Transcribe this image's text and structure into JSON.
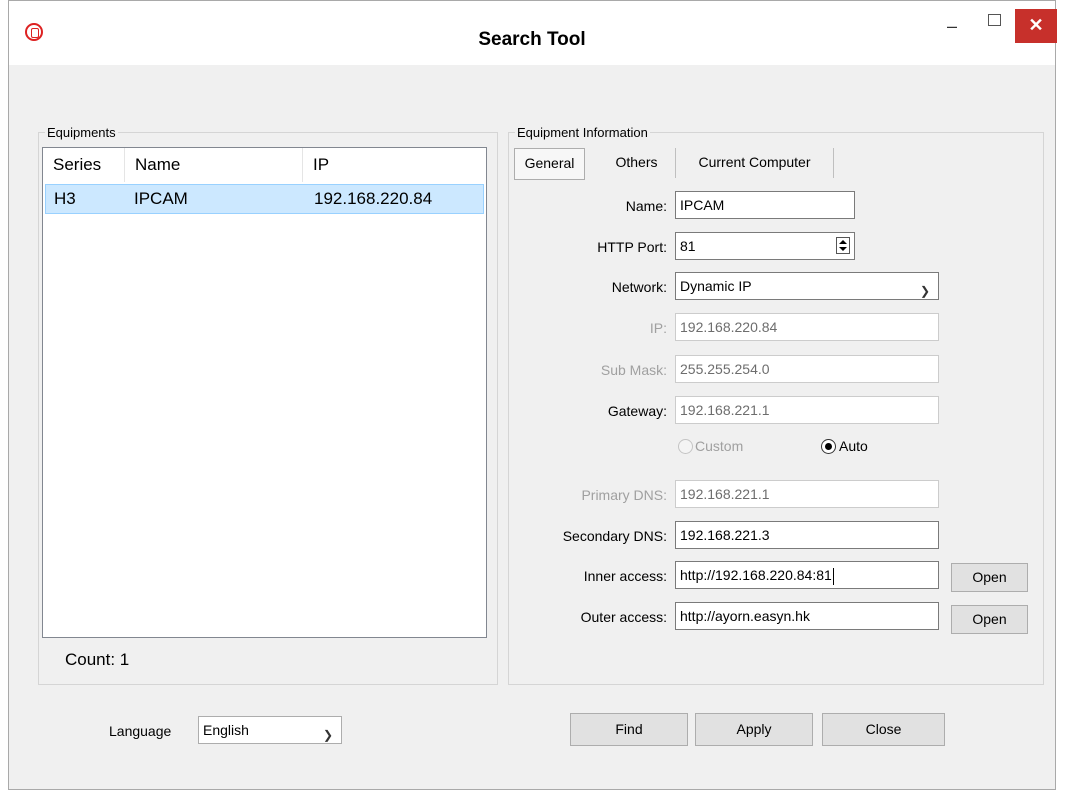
{
  "window": {
    "title": "Search Tool",
    "minimize": "–",
    "close": "✕"
  },
  "equipments": {
    "legend": "Equipments",
    "columns": [
      "Series",
      "Name",
      "IP"
    ],
    "rows": [
      {
        "series": "H3",
        "name": "IPCAM",
        "ip": "192.168.220.84"
      }
    ],
    "count_label": "Count: 1"
  },
  "info": {
    "legend": "Equipment Information",
    "tabs": [
      "General",
      "Others",
      "Current Computer"
    ],
    "name_label": "Name:",
    "name_value": "IPCAM",
    "http_port_label": "HTTP Port:",
    "http_port_value": "81",
    "network_label": "Network:",
    "network_value": "Dynamic IP",
    "ip_label": "IP:",
    "ip_value": "192.168.220.84",
    "submask_label": "Sub Mask:",
    "submask_value": "255.255.254.0",
    "gateway_label": "Gateway:",
    "gateway_value": "192.168.221.1",
    "custom_label": "Custom",
    "auto_label": "Auto",
    "dns1_label": "Primary DNS:",
    "dns1_value": "192.168.221.1",
    "dns2_label": "Secondary DNS:",
    "dns2_value": "192.168.221.3",
    "inner_label": "Inner access:",
    "inner_value": "http://192.168.220.84:81",
    "outer_label": "Outer access:",
    "outer_value": "http://ayorn.easyn.hk",
    "open_label": "Open"
  },
  "footer": {
    "language_label": "Language",
    "language_value": "English",
    "find": "Find",
    "apply": "Apply",
    "close": "Close"
  },
  "colors": {
    "selection": "#cce8ff",
    "close_button": "#c7302b"
  }
}
